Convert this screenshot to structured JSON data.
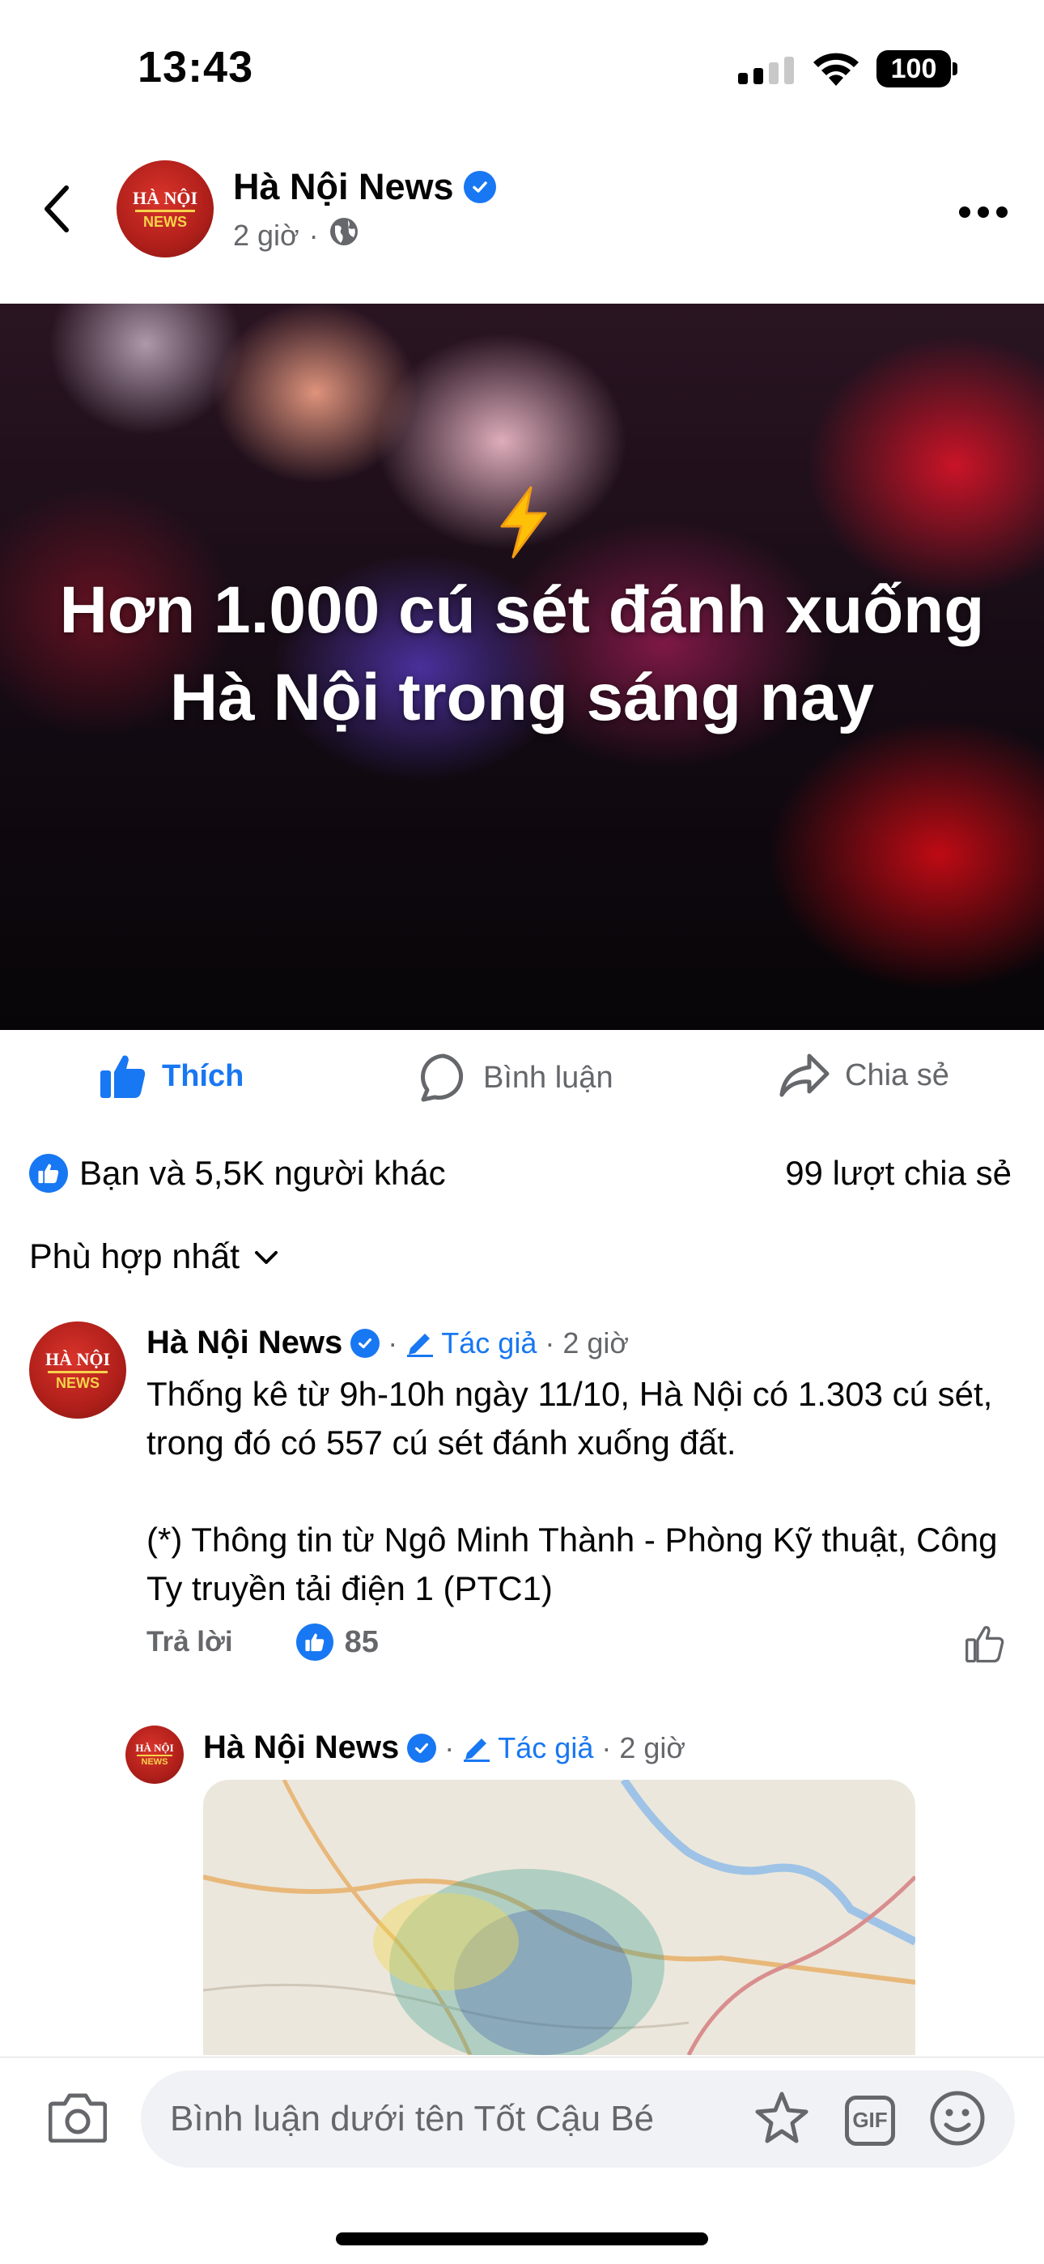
{
  "status_bar": {
    "time": "13:43",
    "battery": "100"
  },
  "header": {
    "page_name": "Hà Nội News",
    "time": "2 giờ",
    "separator": "·",
    "avatar": {
      "line1": "HÀ NỘI",
      "line2": "NEWS"
    }
  },
  "post": {
    "headline": "Hơn 1.000 cú sét đánh xuống Hà Nội trong sáng nay",
    "emoji": "⚡"
  },
  "actions": {
    "like": "Thích",
    "comment": "Bình luận",
    "share": "Chia sẻ"
  },
  "stats": {
    "reactions": "Bạn và 5,5K người khác",
    "shares": "99 lượt chia sẻ"
  },
  "sort": {
    "label": "Phù hợp nhất"
  },
  "comments": [
    {
      "name": "Hà Nội News",
      "badge": "Tác giả",
      "time": "2 giờ",
      "text": "Thống kê từ 9h-10h ngày 11/10, Hà Nội có 1.303 cú sét, trong đó có 557 cú sét đánh xuống đất.\n\n(*) Thông tin từ Ngô Minh Thành - Phòng Kỹ thuật, Công Ty truyền tải điện 1 (PTC1)",
      "reply": "Trả lời",
      "likes": "85"
    },
    {
      "name": "Hà Nội News",
      "badge": "Tác giả",
      "time": "2 giờ"
    }
  ],
  "composer": {
    "placeholder": "Bình luận dưới tên Tốt Cậu Bé",
    "gif": "GIF"
  },
  "colors": {
    "accent": "#1877f2",
    "secondary_text": "#65676b",
    "brand_red": "#b01f1a"
  }
}
